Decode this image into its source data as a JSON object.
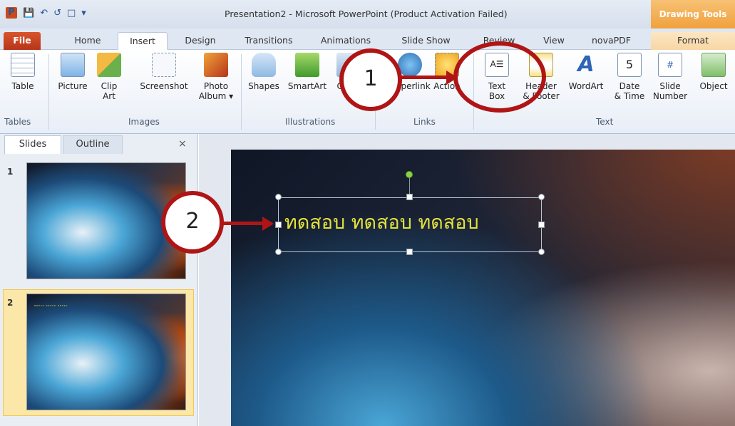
{
  "window": {
    "title": "Presentation2 - Microsoft PowerPoint (Product Activation Failed)",
    "contextual_tab_group": "Drawing Tools",
    "app_icon": "P"
  },
  "tabs": [
    "File",
    "Home",
    "Insert",
    "Design",
    "Transitions",
    "Animations",
    "Slide Show",
    "Review",
    "View",
    "novaPDF",
    "Format"
  ],
  "ribbon": {
    "buttons": {
      "table": "Table",
      "picture": "Picture",
      "clip_art": "Clip\nArt",
      "screenshot": "Screenshot",
      "photo_album": "Photo\nAlbum ▾",
      "shapes": "Shapes",
      "smartart": "SmartArt",
      "chart": "Chart",
      "hyperlink": "Hyperlink",
      "action": "Action",
      "text_box": "Text\nBox",
      "header_footer": "Header\n& Footer",
      "wordart": "WordArt",
      "date_time": "Date\n& Time",
      "slide_number": "Slide\nNumber",
      "object": "Object"
    },
    "groups": {
      "tables": "Tables",
      "images": "Images",
      "illustrations": "Illustrations",
      "links": "Links",
      "text": "Text"
    }
  },
  "panel": {
    "tab_slides": "Slides",
    "tab_outline": "Outline",
    "close": "×",
    "slide_numbers": [
      "1",
      "2"
    ]
  },
  "slide": {
    "textbox_text": "ทดสอบ ทดสอบ ทดสอบ",
    "thumb_text": "ทดสอบ ทดสอบ ทดสอบ"
  },
  "callouts": {
    "one": "1",
    "two": "2"
  },
  "colors": {
    "callout_red": "#b01515",
    "text_yellow": "#e4e23a",
    "file_tab": "#c84a1a",
    "drawing_tools": "#f0a13c"
  }
}
